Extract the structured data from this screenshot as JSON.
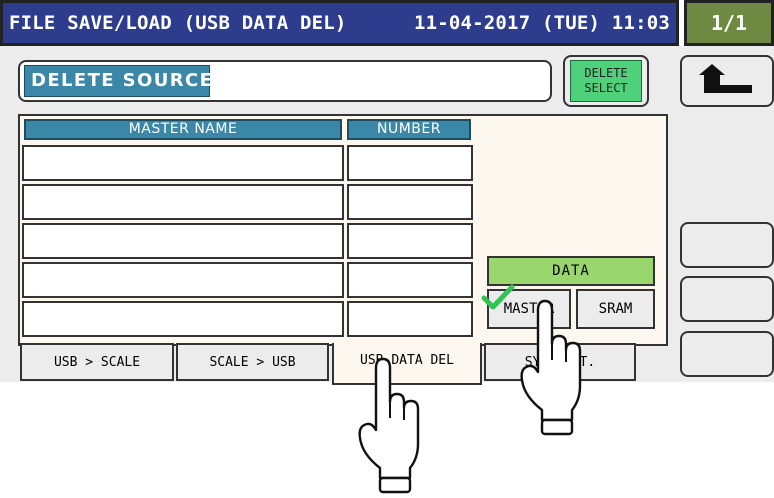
{
  "header": {
    "title": "FILE SAVE/LOAD (USB DATA DEL)",
    "datetime": "11-04-2017 (TUE) 11:03",
    "page": "1/1"
  },
  "source": {
    "label": "DELETE SOURCE",
    "value": ""
  },
  "delete_select": {
    "line1": "DELETE",
    "line2": "SELECT"
  },
  "table": {
    "columns": [
      "MASTER NAME",
      "NUMBER"
    ],
    "rows": [
      {
        "master_name": "",
        "number": ""
      },
      {
        "master_name": "",
        "number": ""
      },
      {
        "master_name": "",
        "number": ""
      },
      {
        "master_name": "",
        "number": ""
      },
      {
        "master_name": "",
        "number": ""
      }
    ]
  },
  "data_group": {
    "label": "DATA",
    "options": [
      {
        "label": "MASTER",
        "checked": true
      },
      {
        "label": "SRAM",
        "checked": false
      }
    ]
  },
  "tabs": [
    {
      "label": "USB > SCALE"
    },
    {
      "label": "SCALE > USB"
    },
    {
      "label": "USB DATA DEL",
      "active": true
    },
    {
      "label": "SYS. DAT."
    }
  ],
  "colors": {
    "title_bg": "#2d3c8c",
    "page_bg": "#6e8a42",
    "label_blue": "#3b87a8",
    "select_green": "#4fd07a",
    "data_green": "#9ad66e",
    "check_green": "#2fc454",
    "content_cream": "#fdf8ef"
  },
  "icons": [
    "back-arrow-icon",
    "checkmark-icon",
    "pointing-hand-icon"
  ]
}
